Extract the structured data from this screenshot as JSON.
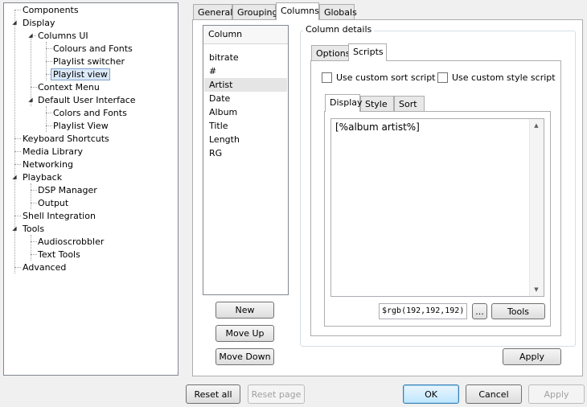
{
  "tree": {
    "components": "Components",
    "display": "Display",
    "columns_ui": "Columns UI",
    "colours_and_fonts": "Colours and Fonts",
    "playlist_switcher": "Playlist switcher",
    "playlist_view": "Playlist view",
    "context_menu": "Context Menu",
    "default_ui": "Default User Interface",
    "colors_and_fonts": "Colors and Fonts",
    "playlist_view_2": "Playlist View",
    "keyboard_shortcuts": "Keyboard Shortcuts",
    "media_library": "Media Library",
    "networking": "Networking",
    "playback": "Playback",
    "dsp_manager": "DSP Manager",
    "output": "Output",
    "shell_integration": "Shell Integration",
    "tools": "Tools",
    "audioscrobbler": "Audioscrobbler",
    "text_tools": "Text Tools",
    "advanced": "Advanced"
  },
  "tabs": {
    "general": "General",
    "grouping": "Grouping",
    "columns": "Columns",
    "globals": "Globals"
  },
  "columns_list": {
    "header": "Column",
    "items": [
      "bitrate",
      "#",
      "Artist",
      "Date",
      "Album",
      "Title",
      "Length",
      "RG"
    ]
  },
  "buttons": {
    "new": "New",
    "move_up": "Move Up",
    "move_down": "Move Down",
    "apply_inner": "Apply",
    "reset_all": "Reset all",
    "reset_page": "Reset page",
    "ok": "OK",
    "cancel": "Cancel",
    "apply": "Apply",
    "ellipsis": "...",
    "tools": "Tools"
  },
  "details": {
    "group_label": "Column details",
    "tab_options": "Options",
    "tab_scripts": "Scripts",
    "custom_sort": "Use custom sort script",
    "custom_style": "Use custom style script",
    "tab_display": "Display",
    "tab_style": "Style",
    "tab_sort": "Sort",
    "script_text": "[%album artist%]",
    "color_value": "$rgb(192,192,192)"
  },
  "icons": {
    "expanded": "expanded-triangle-icon",
    "scroll_up": "scroll-up-icon",
    "scroll_down": "scroll-down-icon"
  }
}
